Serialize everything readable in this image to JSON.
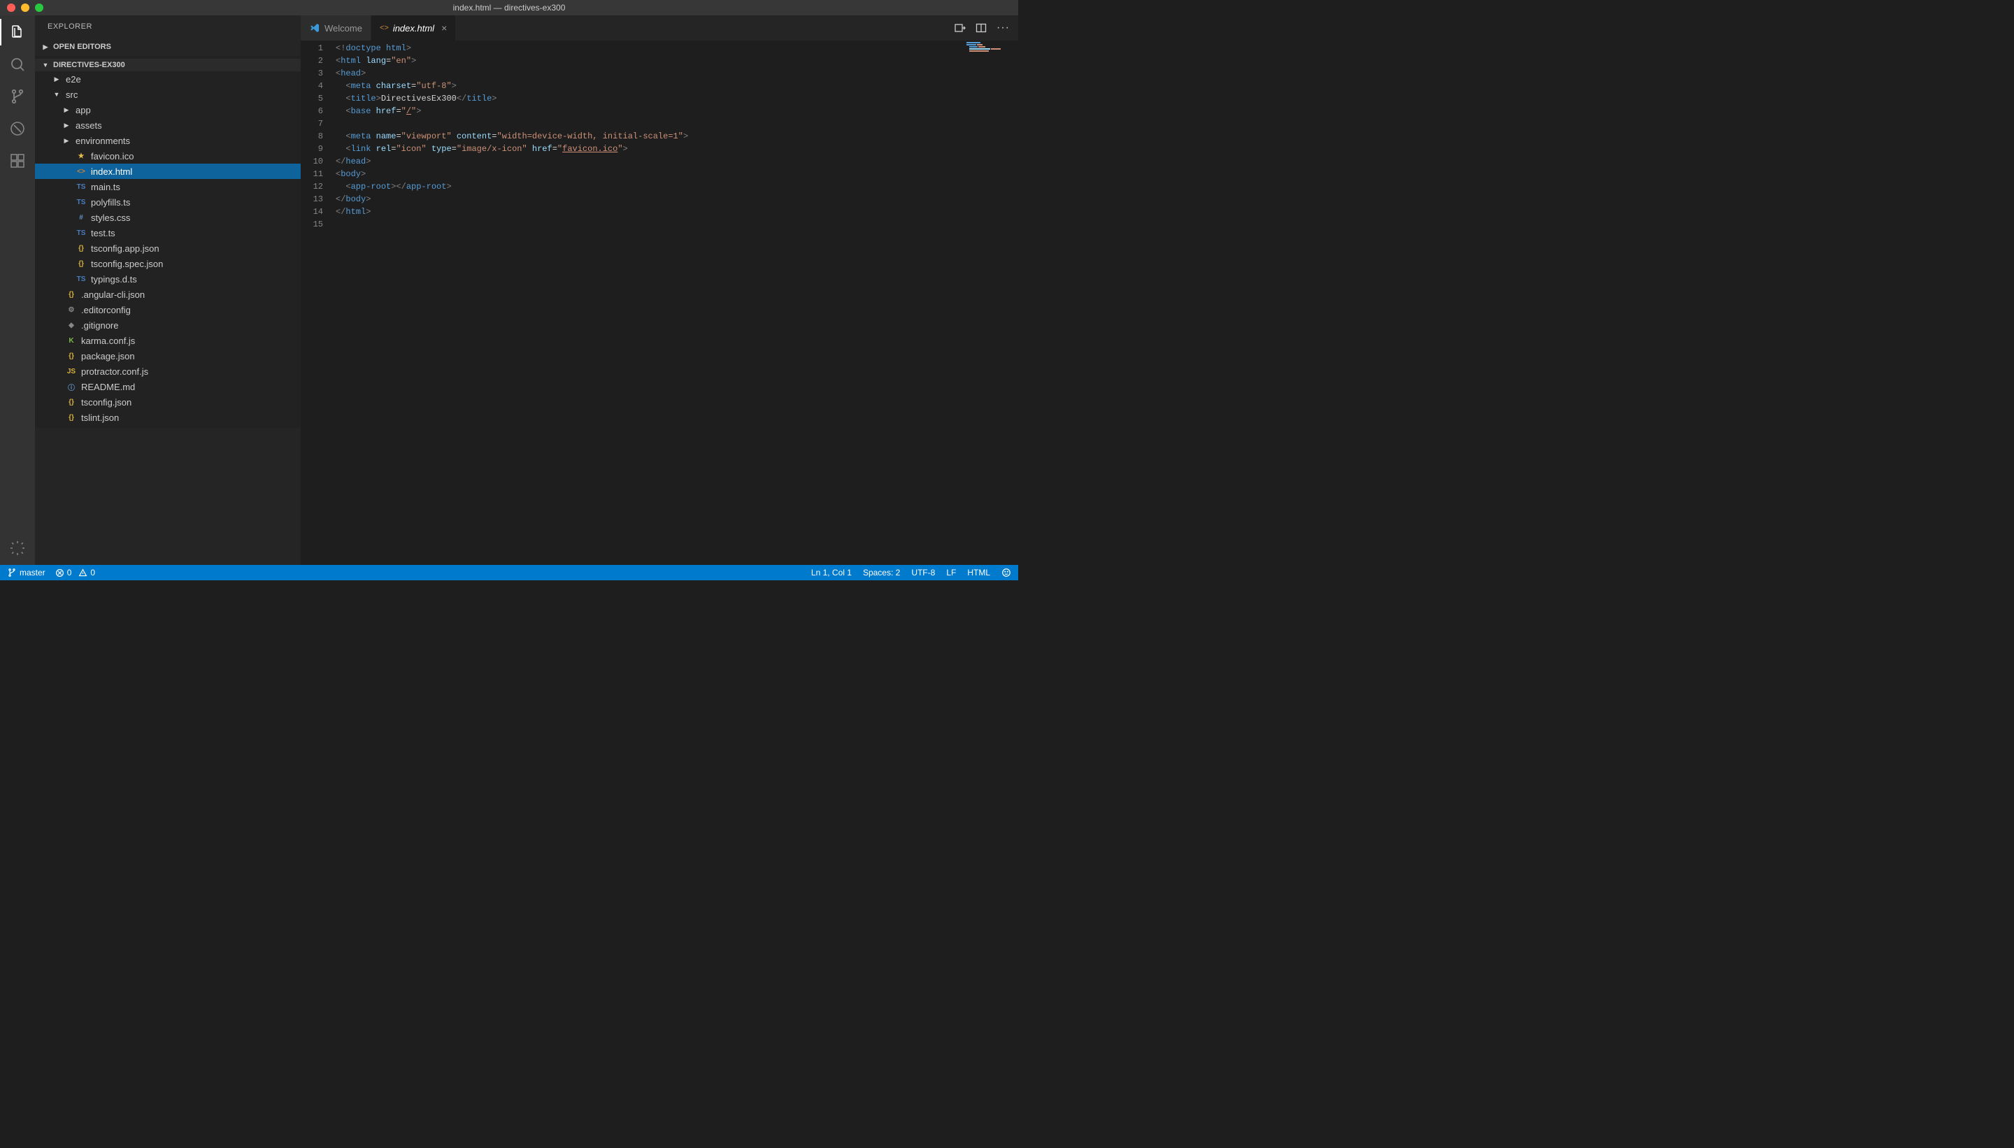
{
  "window": {
    "title": "index.html — directives-ex300"
  },
  "sidebar": {
    "title": "EXPLORER",
    "sections": {
      "openEditors": "OPEN EDITORS",
      "project": "DIRECTIVES-EX300"
    },
    "tree": [
      {
        "name": "e2e",
        "type": "folder",
        "depth": 1,
        "expanded": false
      },
      {
        "name": "src",
        "type": "folder",
        "depth": 1,
        "expanded": true
      },
      {
        "name": "app",
        "type": "folder",
        "depth": 2,
        "expanded": false
      },
      {
        "name": "assets",
        "type": "folder",
        "depth": 2,
        "expanded": false
      },
      {
        "name": "environments",
        "type": "folder",
        "depth": 2,
        "expanded": false
      },
      {
        "name": "favicon.ico",
        "type": "file",
        "icon": "star",
        "iconColor": "#e8bf4d",
        "depth": 2
      },
      {
        "name": "index.html",
        "type": "file",
        "icon": "<>",
        "iconColor": "#c5833b",
        "depth": 2,
        "selected": true
      },
      {
        "name": "main.ts",
        "type": "file",
        "icon": "TS",
        "iconColor": "#4a7dbf",
        "depth": 2
      },
      {
        "name": "polyfills.ts",
        "type": "file",
        "icon": "TS",
        "iconColor": "#4a7dbf",
        "depth": 2
      },
      {
        "name": "styles.css",
        "type": "file",
        "icon": "#",
        "iconColor": "#6196cc",
        "depth": 2
      },
      {
        "name": "test.ts",
        "type": "file",
        "icon": "TS",
        "iconColor": "#4a7dbf",
        "depth": 2
      },
      {
        "name": "tsconfig.app.json",
        "type": "file",
        "icon": "{}",
        "iconColor": "#d8b13b",
        "depth": 2
      },
      {
        "name": "tsconfig.spec.json",
        "type": "file",
        "icon": "{}",
        "iconColor": "#d8b13b",
        "depth": 2
      },
      {
        "name": "typings.d.ts",
        "type": "file",
        "icon": "TS",
        "iconColor": "#4a7dbf",
        "depth": 2
      },
      {
        "name": ".angular-cli.json",
        "type": "file",
        "icon": "{}",
        "iconColor": "#d8b13b",
        "depth": 1
      },
      {
        "name": ".editorconfig",
        "type": "file",
        "icon": "gear",
        "iconColor": "#888",
        "depth": 1
      },
      {
        "name": ".gitignore",
        "type": "file",
        "icon": "diamond",
        "iconColor": "#888",
        "depth": 1
      },
      {
        "name": "karma.conf.js",
        "type": "file",
        "icon": "K",
        "iconColor": "#7fbc42",
        "depth": 1
      },
      {
        "name": "package.json",
        "type": "file",
        "icon": "{}",
        "iconColor": "#d8b13b",
        "depth": 1
      },
      {
        "name": "protractor.conf.js",
        "type": "file",
        "icon": "JS",
        "iconColor": "#d8b13b",
        "depth": 1
      },
      {
        "name": "README.md",
        "type": "file",
        "icon": "info",
        "iconColor": "#6196cc",
        "depth": 1
      },
      {
        "name": "tsconfig.json",
        "type": "file",
        "icon": "{}",
        "iconColor": "#d8b13b",
        "depth": 1
      },
      {
        "name": "tslint.json",
        "type": "file",
        "icon": "{}",
        "iconColor": "#d8b13b",
        "depth": 1
      }
    ]
  },
  "tabs": [
    {
      "label": "Welcome",
      "icon": "vscode",
      "active": false
    },
    {
      "label": "index.html",
      "icon": "<>",
      "active": true,
      "closeVisible": true
    }
  ],
  "code": {
    "lines": [
      [
        {
          "t": "punct",
          "v": "<!"
        },
        {
          "t": "tag",
          "v": "doctype html"
        },
        {
          "t": "punct",
          "v": ">"
        }
      ],
      [
        {
          "t": "punct",
          "v": "<"
        },
        {
          "t": "tag",
          "v": "html"
        },
        {
          "t": "plain",
          "v": " "
        },
        {
          "t": "attr",
          "v": "lang"
        },
        {
          "t": "plain",
          "v": "="
        },
        {
          "t": "str",
          "v": "\"en\""
        },
        {
          "t": "punct",
          "v": ">"
        }
      ],
      [
        {
          "t": "punct",
          "v": "<"
        },
        {
          "t": "tag",
          "v": "head"
        },
        {
          "t": "punct",
          "v": ">"
        }
      ],
      [
        {
          "t": "plain",
          "v": "  "
        },
        {
          "t": "punct",
          "v": "<"
        },
        {
          "t": "tag",
          "v": "meta"
        },
        {
          "t": "plain",
          "v": " "
        },
        {
          "t": "attr",
          "v": "charset"
        },
        {
          "t": "plain",
          "v": "="
        },
        {
          "t": "str",
          "v": "\"utf-8\""
        },
        {
          "t": "punct",
          "v": ">"
        }
      ],
      [
        {
          "t": "plain",
          "v": "  "
        },
        {
          "t": "punct",
          "v": "<"
        },
        {
          "t": "tag",
          "v": "title"
        },
        {
          "t": "punct",
          "v": ">"
        },
        {
          "t": "plain",
          "v": "DirectivesEx300"
        },
        {
          "t": "punct",
          "v": "</"
        },
        {
          "t": "tag",
          "v": "title"
        },
        {
          "t": "punct",
          "v": ">"
        }
      ],
      [
        {
          "t": "plain",
          "v": "  "
        },
        {
          "t": "punct",
          "v": "<"
        },
        {
          "t": "tag",
          "v": "base"
        },
        {
          "t": "plain",
          "v": " "
        },
        {
          "t": "attr",
          "v": "href"
        },
        {
          "t": "plain",
          "v": "="
        },
        {
          "t": "str",
          "v": "\""
        },
        {
          "t": "str-underline",
          "v": "/"
        },
        {
          "t": "str",
          "v": "\""
        },
        {
          "t": "punct",
          "v": ">"
        }
      ],
      [],
      [
        {
          "t": "plain",
          "v": "  "
        },
        {
          "t": "punct",
          "v": "<"
        },
        {
          "t": "tag",
          "v": "meta"
        },
        {
          "t": "plain",
          "v": " "
        },
        {
          "t": "attr",
          "v": "name"
        },
        {
          "t": "plain",
          "v": "="
        },
        {
          "t": "str",
          "v": "\"viewport\""
        },
        {
          "t": "plain",
          "v": " "
        },
        {
          "t": "attr",
          "v": "content"
        },
        {
          "t": "plain",
          "v": "="
        },
        {
          "t": "str",
          "v": "\"width=device-width, initial-scale=1\""
        },
        {
          "t": "punct",
          "v": ">"
        }
      ],
      [
        {
          "t": "plain",
          "v": "  "
        },
        {
          "t": "punct",
          "v": "<"
        },
        {
          "t": "tag",
          "v": "link"
        },
        {
          "t": "plain",
          "v": " "
        },
        {
          "t": "attr",
          "v": "rel"
        },
        {
          "t": "plain",
          "v": "="
        },
        {
          "t": "str",
          "v": "\"icon\""
        },
        {
          "t": "plain",
          "v": " "
        },
        {
          "t": "attr",
          "v": "type"
        },
        {
          "t": "plain",
          "v": "="
        },
        {
          "t": "str",
          "v": "\"image/x-icon\""
        },
        {
          "t": "plain",
          "v": " "
        },
        {
          "t": "attr",
          "v": "href"
        },
        {
          "t": "plain",
          "v": "="
        },
        {
          "t": "str",
          "v": "\""
        },
        {
          "t": "str-underline",
          "v": "favicon.ico"
        },
        {
          "t": "str",
          "v": "\""
        },
        {
          "t": "punct",
          "v": ">"
        }
      ],
      [
        {
          "t": "punct",
          "v": "</"
        },
        {
          "t": "tag",
          "v": "head"
        },
        {
          "t": "punct",
          "v": ">"
        }
      ],
      [
        {
          "t": "punct",
          "v": "<"
        },
        {
          "t": "tag",
          "v": "body"
        },
        {
          "t": "punct",
          "v": ">"
        }
      ],
      [
        {
          "t": "plain",
          "v": "  "
        },
        {
          "t": "punct",
          "v": "<"
        },
        {
          "t": "tag",
          "v": "app-root"
        },
        {
          "t": "punct",
          "v": "></"
        },
        {
          "t": "tag",
          "v": "app-root"
        },
        {
          "t": "punct",
          "v": ">"
        }
      ],
      [
        {
          "t": "punct",
          "v": "</"
        },
        {
          "t": "tag",
          "v": "body"
        },
        {
          "t": "punct",
          "v": ">"
        }
      ],
      [
        {
          "t": "punct",
          "v": "</"
        },
        {
          "t": "tag",
          "v": "html"
        },
        {
          "t": "punct",
          "v": ">"
        }
      ],
      []
    ]
  },
  "status": {
    "branch": "master",
    "errors": "0",
    "warnings": "0",
    "cursor": "Ln 1, Col 1",
    "spaces": "Spaces: 2",
    "encoding": "UTF-8",
    "eol": "LF",
    "language": "HTML"
  }
}
